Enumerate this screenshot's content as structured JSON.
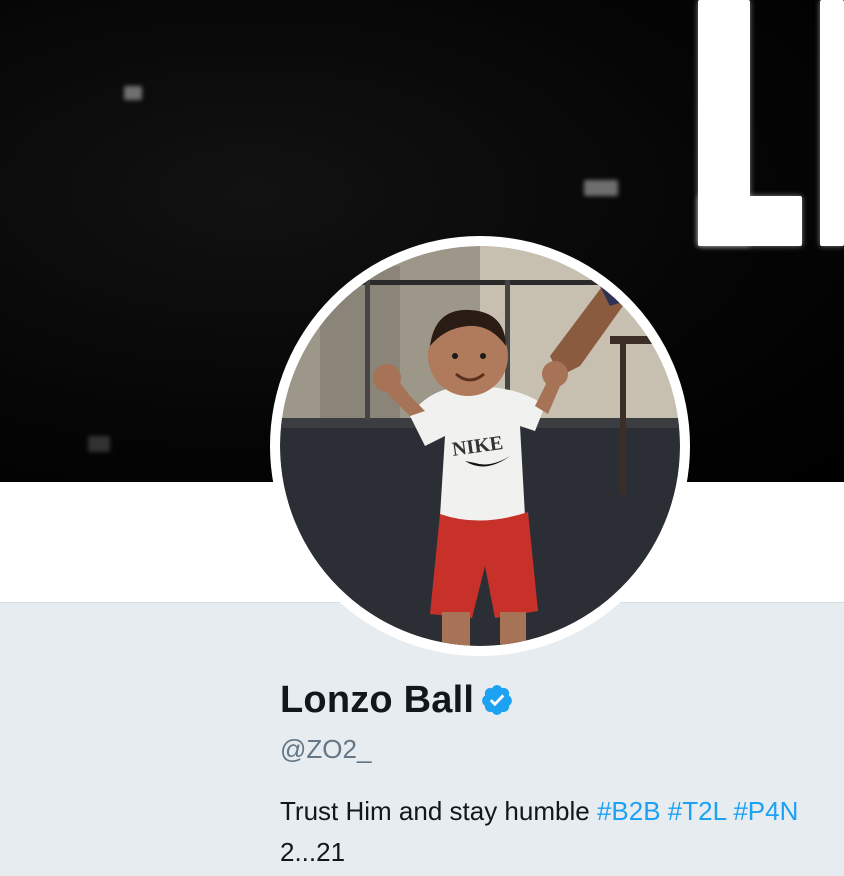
{
  "profile": {
    "name": "Lonzo Ball",
    "handle": "@ZO2_",
    "bio_text": "Trust Him and stay humble",
    "bio_suffix": "2...21",
    "hashtags": [
      "#B2B",
      "#T2L",
      "#P4N"
    ]
  },
  "colors": {
    "link": "#1da1f2",
    "page_background": "#e6ecf0",
    "name_text": "#14171a",
    "handle_text": "#657786"
  },
  "icons": {
    "verified": "verified-badge-icon"
  }
}
